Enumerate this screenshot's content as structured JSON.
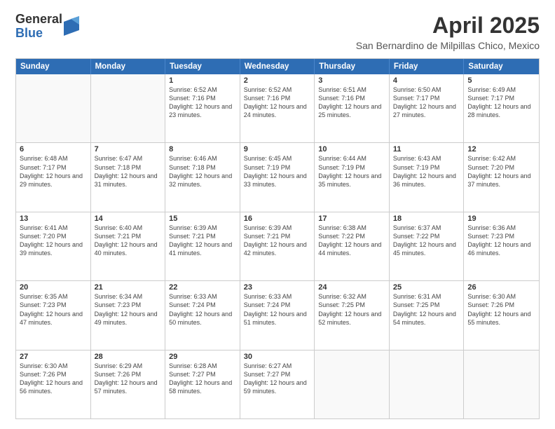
{
  "logo": {
    "general": "General",
    "blue": "Blue"
  },
  "title": "April 2025",
  "subtitle": "San Bernardino de Milpillas Chico, Mexico",
  "headers": [
    "Sunday",
    "Monday",
    "Tuesday",
    "Wednesday",
    "Thursday",
    "Friday",
    "Saturday"
  ],
  "weeks": [
    [
      {
        "day": "",
        "info": ""
      },
      {
        "day": "",
        "info": ""
      },
      {
        "day": "1",
        "info": "Sunrise: 6:52 AM\nSunset: 7:16 PM\nDaylight: 12 hours and 23 minutes."
      },
      {
        "day": "2",
        "info": "Sunrise: 6:52 AM\nSunset: 7:16 PM\nDaylight: 12 hours and 24 minutes."
      },
      {
        "day": "3",
        "info": "Sunrise: 6:51 AM\nSunset: 7:16 PM\nDaylight: 12 hours and 25 minutes."
      },
      {
        "day": "4",
        "info": "Sunrise: 6:50 AM\nSunset: 7:17 PM\nDaylight: 12 hours and 27 minutes."
      },
      {
        "day": "5",
        "info": "Sunrise: 6:49 AM\nSunset: 7:17 PM\nDaylight: 12 hours and 28 minutes."
      }
    ],
    [
      {
        "day": "6",
        "info": "Sunrise: 6:48 AM\nSunset: 7:17 PM\nDaylight: 12 hours and 29 minutes."
      },
      {
        "day": "7",
        "info": "Sunrise: 6:47 AM\nSunset: 7:18 PM\nDaylight: 12 hours and 31 minutes."
      },
      {
        "day": "8",
        "info": "Sunrise: 6:46 AM\nSunset: 7:18 PM\nDaylight: 12 hours and 32 minutes."
      },
      {
        "day": "9",
        "info": "Sunrise: 6:45 AM\nSunset: 7:19 PM\nDaylight: 12 hours and 33 minutes."
      },
      {
        "day": "10",
        "info": "Sunrise: 6:44 AM\nSunset: 7:19 PM\nDaylight: 12 hours and 35 minutes."
      },
      {
        "day": "11",
        "info": "Sunrise: 6:43 AM\nSunset: 7:19 PM\nDaylight: 12 hours and 36 minutes."
      },
      {
        "day": "12",
        "info": "Sunrise: 6:42 AM\nSunset: 7:20 PM\nDaylight: 12 hours and 37 minutes."
      }
    ],
    [
      {
        "day": "13",
        "info": "Sunrise: 6:41 AM\nSunset: 7:20 PM\nDaylight: 12 hours and 39 minutes."
      },
      {
        "day": "14",
        "info": "Sunrise: 6:40 AM\nSunset: 7:21 PM\nDaylight: 12 hours and 40 minutes."
      },
      {
        "day": "15",
        "info": "Sunrise: 6:39 AM\nSunset: 7:21 PM\nDaylight: 12 hours and 41 minutes."
      },
      {
        "day": "16",
        "info": "Sunrise: 6:39 AM\nSunset: 7:21 PM\nDaylight: 12 hours and 42 minutes."
      },
      {
        "day": "17",
        "info": "Sunrise: 6:38 AM\nSunset: 7:22 PM\nDaylight: 12 hours and 44 minutes."
      },
      {
        "day": "18",
        "info": "Sunrise: 6:37 AM\nSunset: 7:22 PM\nDaylight: 12 hours and 45 minutes."
      },
      {
        "day": "19",
        "info": "Sunrise: 6:36 AM\nSunset: 7:23 PM\nDaylight: 12 hours and 46 minutes."
      }
    ],
    [
      {
        "day": "20",
        "info": "Sunrise: 6:35 AM\nSunset: 7:23 PM\nDaylight: 12 hours and 47 minutes."
      },
      {
        "day": "21",
        "info": "Sunrise: 6:34 AM\nSunset: 7:23 PM\nDaylight: 12 hours and 49 minutes."
      },
      {
        "day": "22",
        "info": "Sunrise: 6:33 AM\nSunset: 7:24 PM\nDaylight: 12 hours and 50 minutes."
      },
      {
        "day": "23",
        "info": "Sunrise: 6:33 AM\nSunset: 7:24 PM\nDaylight: 12 hours and 51 minutes."
      },
      {
        "day": "24",
        "info": "Sunrise: 6:32 AM\nSunset: 7:25 PM\nDaylight: 12 hours and 52 minutes."
      },
      {
        "day": "25",
        "info": "Sunrise: 6:31 AM\nSunset: 7:25 PM\nDaylight: 12 hours and 54 minutes."
      },
      {
        "day": "26",
        "info": "Sunrise: 6:30 AM\nSunset: 7:26 PM\nDaylight: 12 hours and 55 minutes."
      }
    ],
    [
      {
        "day": "27",
        "info": "Sunrise: 6:30 AM\nSunset: 7:26 PM\nDaylight: 12 hours and 56 minutes."
      },
      {
        "day": "28",
        "info": "Sunrise: 6:29 AM\nSunset: 7:26 PM\nDaylight: 12 hours and 57 minutes."
      },
      {
        "day": "29",
        "info": "Sunrise: 6:28 AM\nSunset: 7:27 PM\nDaylight: 12 hours and 58 minutes."
      },
      {
        "day": "30",
        "info": "Sunrise: 6:27 AM\nSunset: 7:27 PM\nDaylight: 12 hours and 59 minutes."
      },
      {
        "day": "",
        "info": ""
      },
      {
        "day": "",
        "info": ""
      },
      {
        "day": "",
        "info": ""
      }
    ]
  ]
}
